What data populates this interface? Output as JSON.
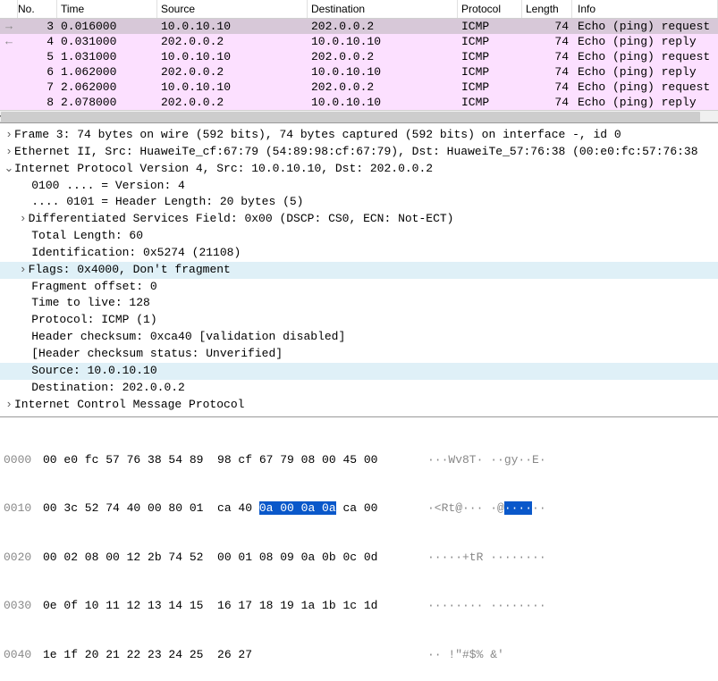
{
  "columns": {
    "no": "No.",
    "time": "Time",
    "source": "Source",
    "destination": "Destination",
    "protocol": "Protocol",
    "length": "Length",
    "info": "Info"
  },
  "packets": [
    {
      "arrow": "→",
      "no": "3",
      "time": "0.016000",
      "src": "10.0.10.10",
      "dst": "202.0.0.2",
      "proto": "ICMP",
      "len": "74",
      "info": "Echo (ping) request"
    },
    {
      "arrow": "←",
      "no": "4",
      "time": "0.031000",
      "src": "202.0.0.2",
      "dst": "10.0.10.10",
      "proto": "ICMP",
      "len": "74",
      "info": "Echo (ping) reply"
    },
    {
      "arrow": "",
      "no": "5",
      "time": "1.031000",
      "src": "10.0.10.10",
      "dst": "202.0.0.2",
      "proto": "ICMP",
      "len": "74",
      "info": "Echo (ping) request"
    },
    {
      "arrow": "",
      "no": "6",
      "time": "1.062000",
      "src": "202.0.0.2",
      "dst": "10.0.10.10",
      "proto": "ICMP",
      "len": "74",
      "info": "Echo (ping) reply"
    },
    {
      "arrow": "",
      "no": "7",
      "time": "2.062000",
      "src": "10.0.10.10",
      "dst": "202.0.0.2",
      "proto": "ICMP",
      "len": "74",
      "info": "Echo (ping) request"
    },
    {
      "arrow": "",
      "no": "8",
      "time": "2.078000",
      "src": "202.0.0.2",
      "dst": "10.0.10.10",
      "proto": "ICMP",
      "len": "74",
      "info": "Echo (ping) reply"
    }
  ],
  "details": {
    "frame": "Frame 3: 74 bytes on wire (592 bits), 74 bytes captured (592 bits) on interface -, id 0",
    "eth": "Ethernet II, Src: HuaweiTe_cf:67:79 (54:89:98:cf:67:79), Dst: HuaweiTe_57:76:38 (00:e0:fc:57:76:38",
    "ip": "Internet Protocol Version 4, Src: 10.0.10.10, Dst: 202.0.0.2",
    "ip_ver": "0100 .... = Version: 4",
    "ip_hlen": ".... 0101 = Header Length: 20 bytes (5)",
    "ip_dsf": "Differentiated Services Field: 0x00 (DSCP: CS0, ECN: Not-ECT)",
    "ip_tlen": "Total Length: 60",
    "ip_id": "Identification: 0x5274 (21108)",
    "ip_flags": "Flags: 0x4000, Don't fragment",
    "ip_foff": "Fragment offset: 0",
    "ip_ttl": "Time to live: 128",
    "ip_proto": "Protocol: ICMP (1)",
    "ip_cksum": "Header checksum: 0xca40 [validation disabled]",
    "ip_ckst": "[Header checksum status: Unverified]",
    "ip_src": "Source: 10.0.10.10",
    "ip_dst": "Destination: 202.0.0.2",
    "icmp": "Internet Control Message Protocol"
  },
  "hex": [
    {
      "off": "0000",
      "b1": "00 e0 fc 57 76 38 54 89  98 cf 67 79 08 00 45 00",
      "a": "···Wv8T· ··gy··E·"
    },
    {
      "off": "0010",
      "b1": "00 3c 52 74 40 00 80 01  ca 40 ",
      "sel": "0a 00 0a 0a",
      "b2": " ca 00",
      "a": "·<Rt@··· ·@",
      "asel": "····",
      "a2": "··"
    },
    {
      "off": "0020",
      "b1": "00 02 08 00 12 2b 74 52  00 01 08 09 0a 0b 0c 0d",
      "a": "·····+tR ········"
    },
    {
      "off": "0030",
      "b1": "0e 0f 10 11 12 13 14 15  16 17 18 19 1a 1b 1c 1d",
      "a": "········ ········"
    },
    {
      "off": "0040",
      "b1": "1e 1f 20 21 22 23 24 25  26 27",
      "a": "·· !\"#$% &'"
    }
  ]
}
